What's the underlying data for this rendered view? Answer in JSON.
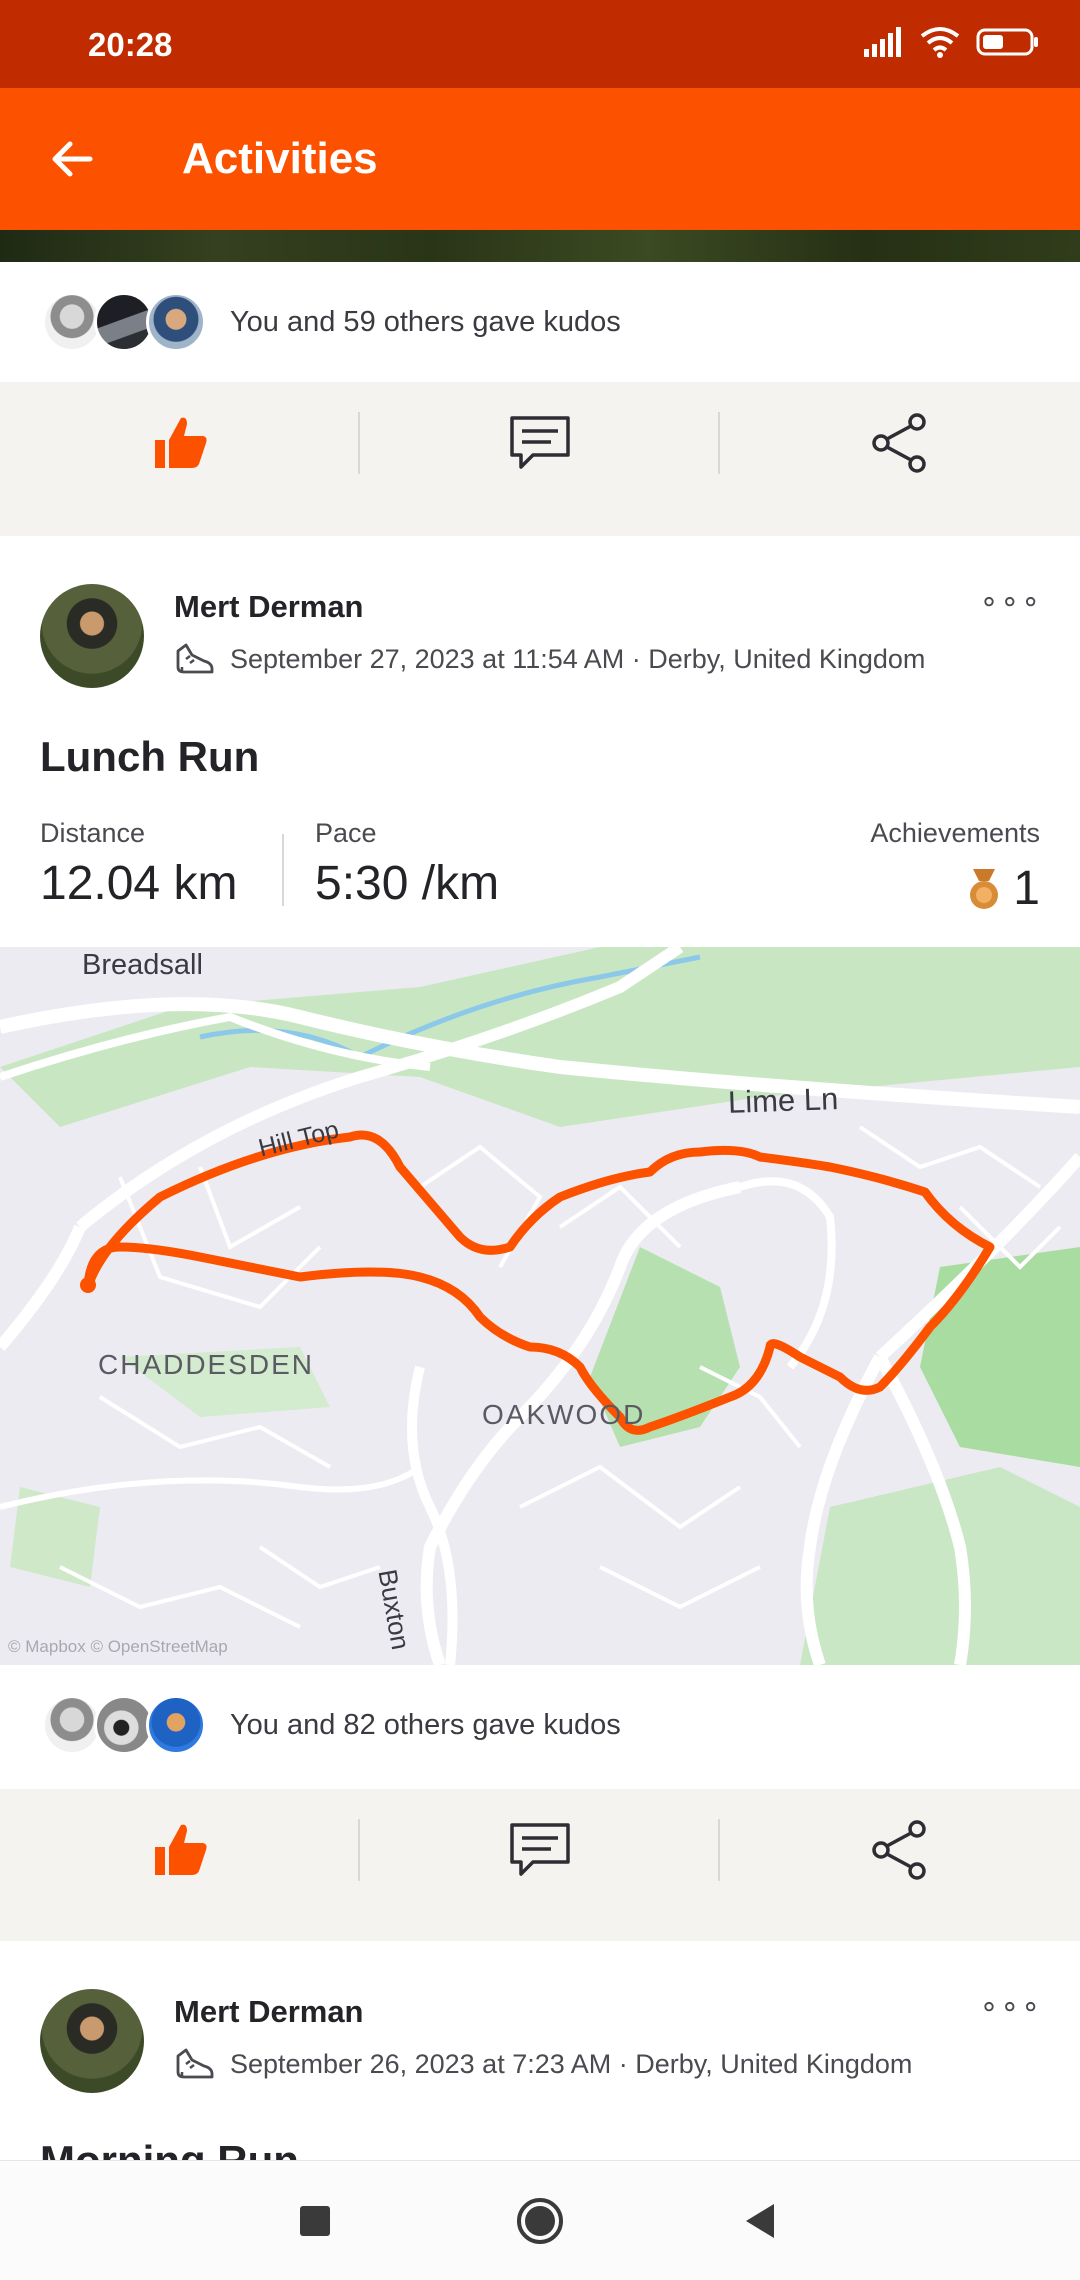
{
  "status_bar": {
    "time": "20:28"
  },
  "app_bar": {
    "title": "Activities"
  },
  "kudos_top": {
    "text": "You and 59 others gave kudos"
  },
  "activity_1": {
    "athlete": "Mert Derman",
    "datetime_location": "September 27, 2023 at 11:54 AM · Derby, United Kingdom",
    "title": "Lunch Run",
    "stats": {
      "distance_label": "Distance",
      "distance_value": "12.04 km",
      "pace_label": "Pace",
      "pace_value": "5:30 /km",
      "achievements_label": "Achievements",
      "achievements_value": "1"
    },
    "map": {
      "labels": {
        "breadsall": "Breadsall",
        "lime_ln": "Lime Ln",
        "hill_top": "Hill Top",
        "chaddesden": "CHADDESDEN",
        "oakwood": "OAKWOOD",
        "buxton": "Buxton",
        "attribution": "© Mapbox © OpenStreetMap"
      },
      "route_color": "#fc5200"
    },
    "kudos": {
      "text": "You and 82 others gave kudos"
    }
  },
  "activity_2": {
    "athlete": "Mert Derman",
    "datetime_location": "September 26, 2023 at 7:23 AM · Derby, United Kingdom",
    "title": "Morning Run"
  },
  "colors": {
    "brand": "#fc5200",
    "status": "#c02c00"
  },
  "icons": [
    "back-arrow-icon",
    "kudos-thumb-icon",
    "comment-icon",
    "share-icon",
    "shoe-icon",
    "medal-icon",
    "more-dots-icon"
  ]
}
